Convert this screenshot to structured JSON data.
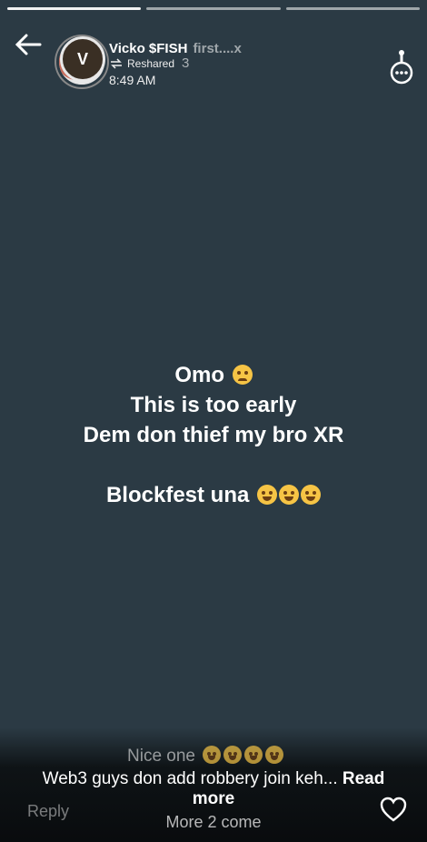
{
  "story": {
    "segments": 3,
    "active_segment": 1
  },
  "header": {
    "avatar_letter": "V",
    "name": "Vicko $FISH",
    "name_overlay": "first....x",
    "reshared_label": "Reshared",
    "sub_overlay": "3",
    "time": "8:49 AM"
  },
  "status": {
    "line1": "Omo",
    "line2": "This is too early",
    "line3": "Dem don thief my bro XR",
    "line4": "Blockfest una"
  },
  "footer": {
    "reply_preview": "Nice one",
    "caption": "Web3 guys don add robbery join keh...",
    "read_more": "Read more",
    "reply_label": "Reply",
    "more_come": "More 2 come"
  },
  "colors": {
    "background": "#2b3a44",
    "text": "#ffffff",
    "emoji": "#f6c445"
  },
  "icons": [
    "back-arrow-icon",
    "reshare-icon",
    "more-options-icon",
    "heart-icon",
    "emoji-icon"
  ]
}
